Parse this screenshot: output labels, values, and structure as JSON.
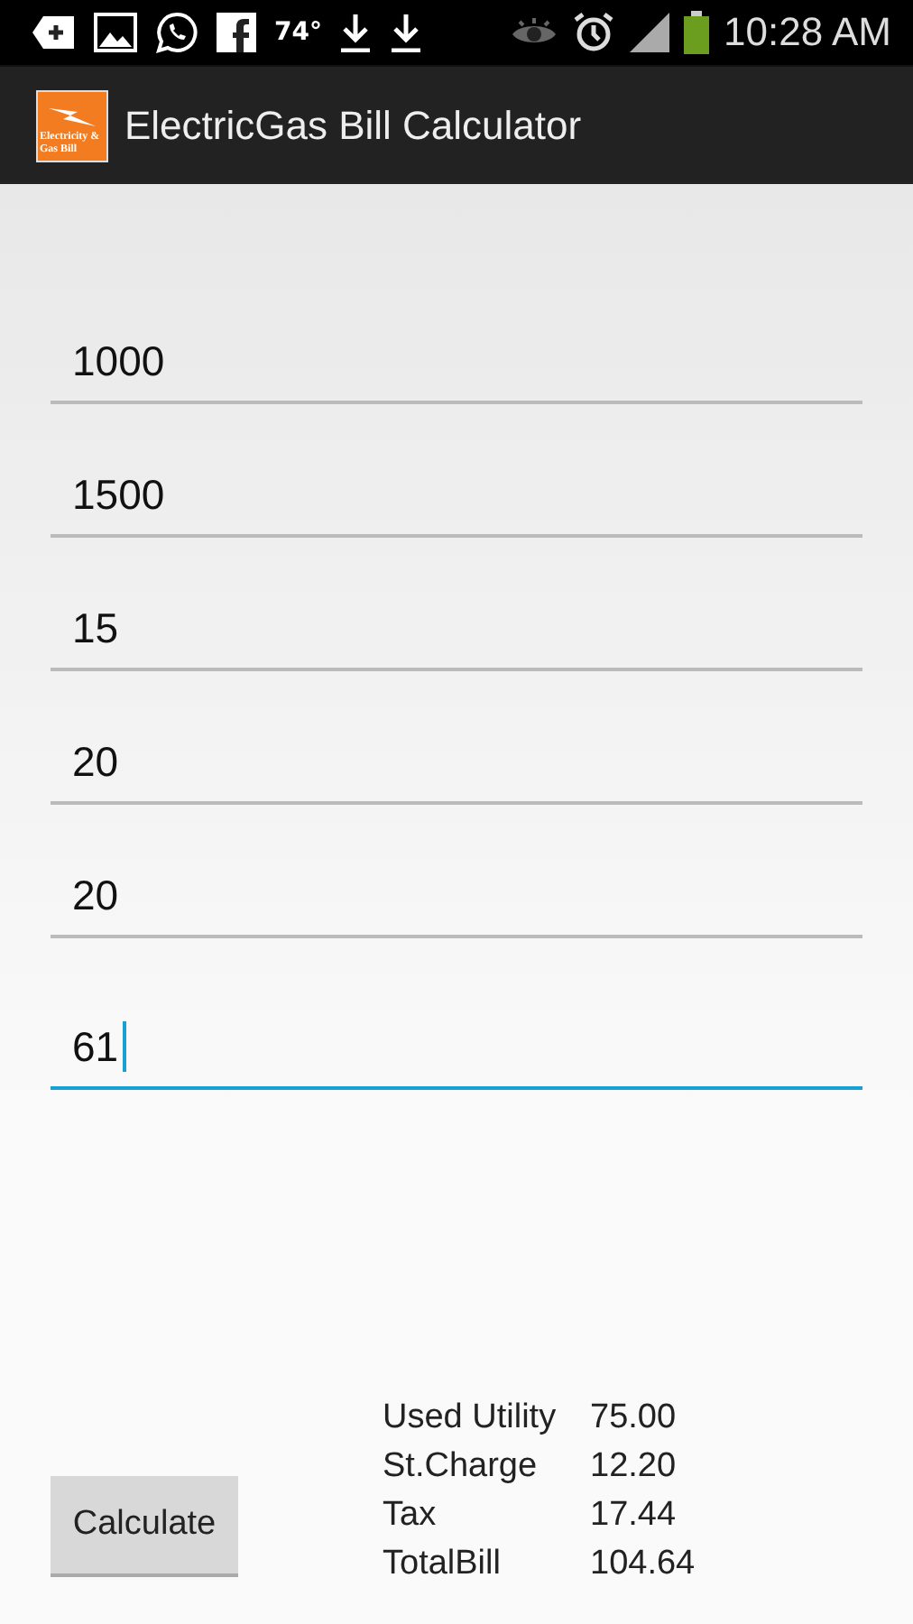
{
  "status_bar": {
    "temperature": "74°",
    "time": "10:28 AM"
  },
  "app_bar": {
    "icon_text": "Electricity & Gas Bill",
    "title": "ElectricGas Bill Calculator"
  },
  "fields": [
    {
      "value": "1000",
      "focused": false
    },
    {
      "value": "1500",
      "focused": false
    },
    {
      "value": "15",
      "focused": false
    },
    {
      "value": "20",
      "focused": false
    },
    {
      "value": "20",
      "focused": false
    },
    {
      "value": "61",
      "focused": true
    }
  ],
  "calculate_button": "Calculate",
  "results": [
    {
      "label": "Used Utility",
      "value": "75.00"
    },
    {
      "label": "St.Charge",
      "value": "12.20"
    },
    {
      "label": "Tax",
      "value": "17.44"
    },
    {
      "label": "TotalBill",
      "value": "104.64"
    }
  ]
}
